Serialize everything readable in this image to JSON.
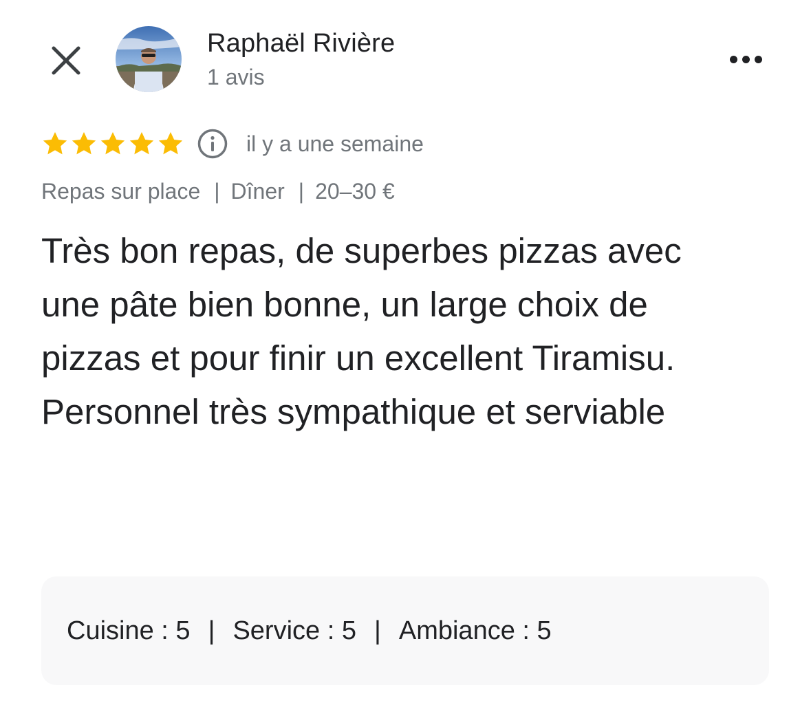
{
  "author": {
    "name": "Raphaël Rivière",
    "review_count": "1 avis"
  },
  "review": {
    "rating": 5,
    "date": "il y a une semaine",
    "meta": [
      "Repas sur place",
      "Dîner",
      "20–30 €"
    ],
    "meta_separator": "|",
    "text_paragraphs": [
      "Très bon repas, de superbes pizzas avec une pâte bien bonne, un large choix de pizzas et pour finir un excellent Tiramisu.",
      "Personnel très sympathique et serviable"
    ]
  },
  "subratings": [
    {
      "label": "Cuisine",
      "value": "5"
    },
    {
      "label": "Service",
      "value": "5"
    },
    {
      "label": "Ambiance",
      "value": "5"
    }
  ],
  "colors": {
    "star": "#fbbc04",
    "text_primary": "#202124",
    "text_secondary": "#70757a",
    "panel_bg": "#f8f8f9"
  },
  "icons": {
    "close": "close-icon",
    "more": "more-horizontal-icon",
    "info": "info-icon",
    "star": "star-icon"
  }
}
